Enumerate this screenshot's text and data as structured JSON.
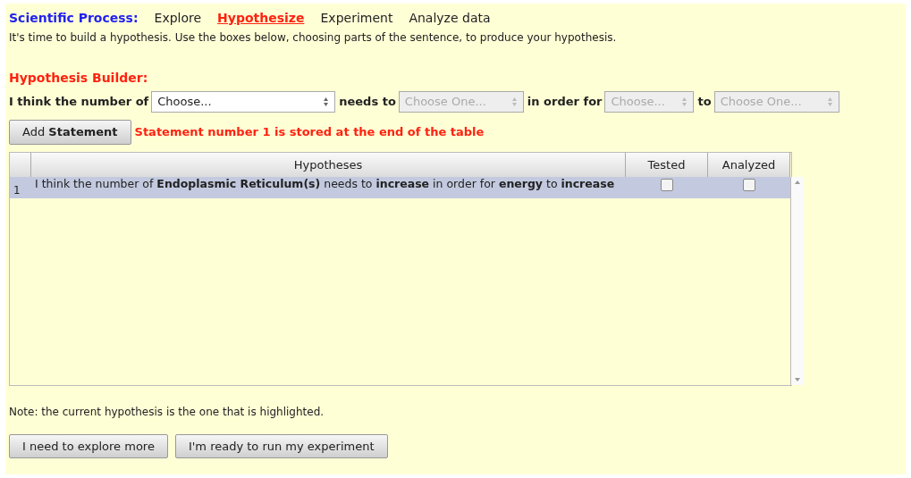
{
  "process_nav": {
    "label": "Scientific Process:",
    "steps": [
      {
        "label": "Explore",
        "selected": false
      },
      {
        "label": "Hypothesize",
        "selected": true
      },
      {
        "label": "Experiment",
        "selected": false
      },
      {
        "label": "Analyze data",
        "selected": false
      }
    ]
  },
  "intro": "It's time to build a hypothesis. Use the boxes below, choosing parts of the sentence, to produce your hypothesis.",
  "builder": {
    "title": "Hypothesis Builder:",
    "parts": [
      {
        "kind": "text",
        "text": "I think the number of"
      },
      {
        "kind": "select",
        "value": "Choose...",
        "disabled": false
      },
      {
        "kind": "text",
        "text": "needs to"
      },
      {
        "kind": "select",
        "value": "Choose One...",
        "disabled": true
      },
      {
        "kind": "text",
        "text": "in order for"
      },
      {
        "kind": "select",
        "value": "Choose...",
        "disabled": true
      },
      {
        "kind": "text",
        "text": "to"
      },
      {
        "kind": "select",
        "value": "Choose One...",
        "disabled": true
      }
    ],
    "add_button": "Add **Statement**",
    "message": "Statement number 1 is stored at the end of the table"
  },
  "table": {
    "columns": [
      "Hypotheses",
      "Tested",
      "Analyzed"
    ],
    "rows": [
      {
        "number": "1",
        "text": "I think the number of **Endoplasmic Reticulum(s)** needs to **increase** in order for **energy** to **increase**",
        "tested": false,
        "analyzed": false,
        "selected": true
      }
    ]
  },
  "note": "Note: the current hypothesis is the one that is highlighted.",
  "buttons": [
    "I need to explore more",
    "I'm ready to run my experiment"
  ]
}
